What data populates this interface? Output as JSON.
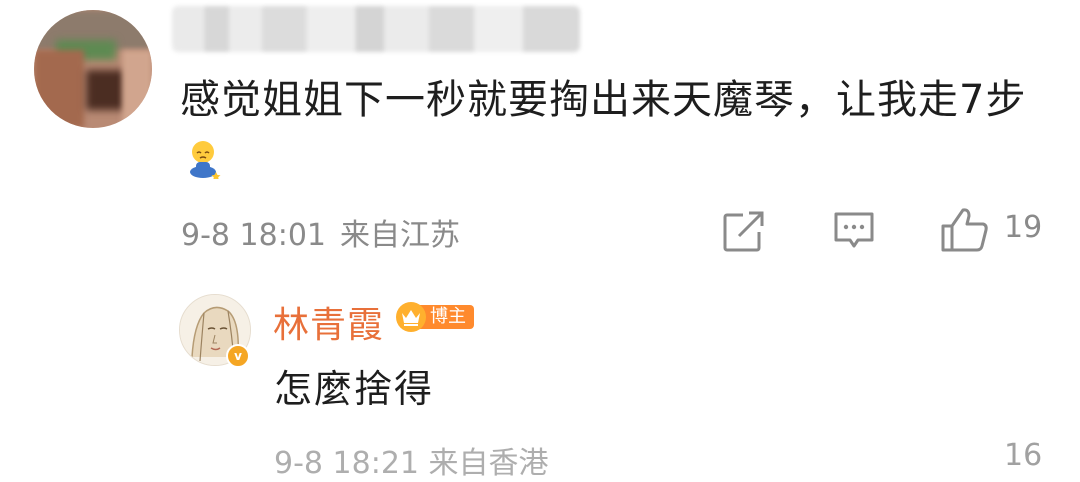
{
  "comment": {
    "text": "感觉姐姐下一秒就要掏出来天魔琴，让我走7步",
    "emoji": "sitting-sad-face-emoji",
    "date": "9-8 18:01",
    "location": "来自江苏",
    "like_count": "19"
  },
  "reply": {
    "author": "林青霞",
    "author_color": "#e8703a",
    "badge": "博主",
    "text": "怎麼捨得",
    "meta_partial": "9-8 18:21 来自香港",
    "like_count_partial": "16"
  },
  "icons": [
    "repost-icon",
    "comment-icon",
    "like-icon",
    "verified-badge-icon",
    "crown-icon"
  ]
}
